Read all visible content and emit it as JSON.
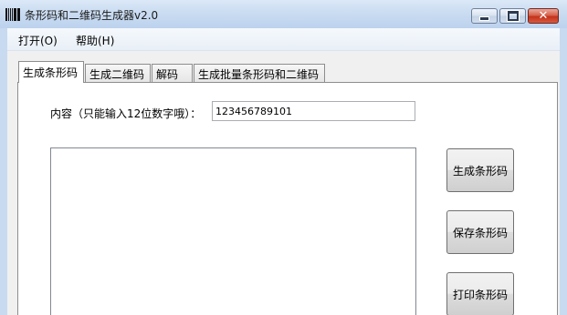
{
  "window": {
    "title": "条形码和二维码生成器v2.0",
    "icon": "barcode-icon",
    "controls": {
      "minimize": "minimize-icon",
      "maximize": "maximize-icon",
      "close": "close-icon",
      "close_glyph": "✕"
    }
  },
  "menu": {
    "open": "打开(O)",
    "help": "帮助(H)"
  },
  "tabs": [
    {
      "label": "生成条形码",
      "active": true
    },
    {
      "label": "生成二维码",
      "active": false
    },
    {
      "label": "解码",
      "active": false
    },
    {
      "label": "生成批量条形码和二维码",
      "active": false
    }
  ],
  "barcode_tab": {
    "content_label": "内容（只能输入12位数字哦）：",
    "content_value": "123456789101",
    "buttons": {
      "generate": "生成条形码",
      "save": "保存条形码",
      "print": "打印条形码"
    }
  },
  "colors": {
    "titlebar": "#c9dbf1",
    "client_bg": "#f0f0f0",
    "close_button": "#c4331c"
  }
}
